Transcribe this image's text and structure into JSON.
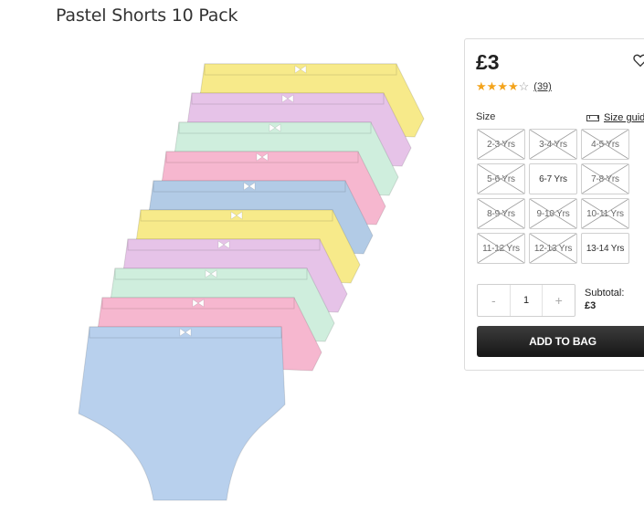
{
  "product": {
    "title": "Pastel Shorts 10 Pack",
    "image_alt": "Pastel Shorts 10 Pack",
    "colors": [
      "#f7ea8a",
      "#e6c3e8",
      "#cfeedd",
      "#f6b7cf",
      "#b2cbe6",
      "#f7ea8a",
      "#e6c3e8",
      "#cfeedd",
      "#f6b7cf",
      "#b8d0ed"
    ]
  },
  "purchase": {
    "price": "£3",
    "rating": 4,
    "rating_max": 5,
    "review_count": "(39)",
    "size_label": "Size",
    "size_guide_label": "Size guide",
    "sizes": [
      {
        "label": "2-3 Yrs",
        "available": false
      },
      {
        "label": "3-4 Yrs",
        "available": false
      },
      {
        "label": "4-5 Yrs",
        "available": false
      },
      {
        "label": "5-6 Yrs",
        "available": false
      },
      {
        "label": "6-7 Yrs",
        "available": true
      },
      {
        "label": "7-8 Yrs",
        "available": false
      },
      {
        "label": "8-9 Yrs",
        "available": false
      },
      {
        "label": "9-10 Yrs",
        "available": false
      },
      {
        "label": "10-11 Yrs",
        "available": false
      },
      {
        "label": "11-12 Yrs",
        "available": false
      },
      {
        "label": "12-13 Yrs",
        "available": false
      },
      {
        "label": "13-14 Yrs",
        "available": true
      }
    ],
    "quantity": {
      "minus": "-",
      "value": "1",
      "plus": "+"
    },
    "subtotal_label": "Subtotal:",
    "subtotal_value": "£3",
    "add_to_bag": "ADD TO BAG"
  }
}
